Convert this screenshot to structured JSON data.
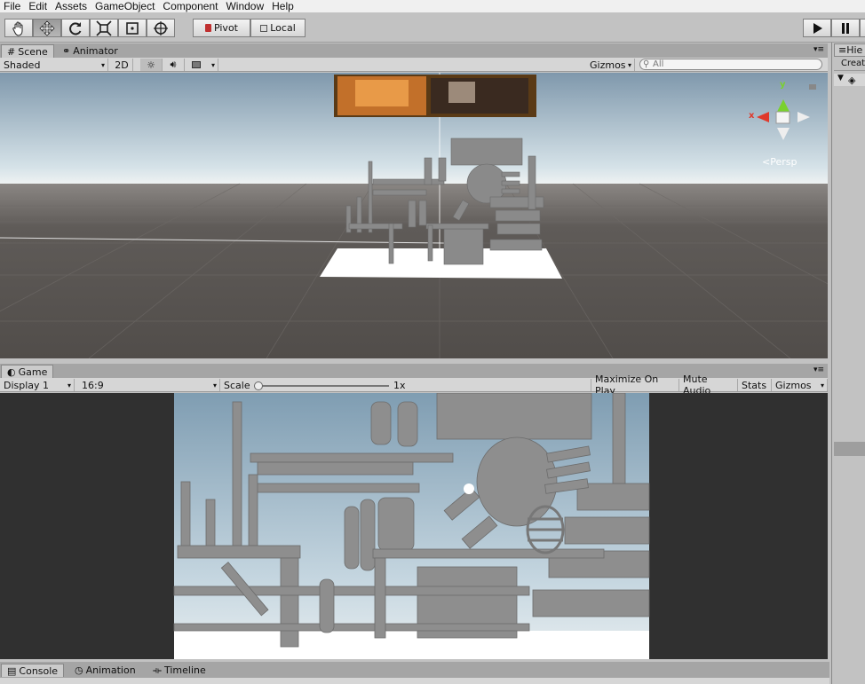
{
  "menu": [
    "File",
    "Edit",
    "Assets",
    "GameObject",
    "Component",
    "Window",
    "Help"
  ],
  "toolbar": {
    "tools": [
      "hand-tool",
      "move-tool",
      "rotate-tool",
      "scale-tool",
      "rect-tool",
      "transform-tool"
    ],
    "pivot_label": "Pivot",
    "local_label": "Local"
  },
  "scene_panel": {
    "tabs": [
      "Scene",
      "Animator"
    ],
    "shading_mode": "Shaded",
    "mode_2d": "2D",
    "gizmos_label": "Gizmos",
    "search_placeholder": "All",
    "persp_label": "Persp",
    "axis_x": "x",
    "axis_y": "y"
  },
  "game_panel": {
    "tab": "Game",
    "display": "Display 1",
    "aspect": "16:9",
    "scale_label": "Scale",
    "scale_value": "1x",
    "scale_level": 0.0,
    "maximize_label": "Maximize On Play",
    "mute_label": "Mute Audio",
    "stats_label": "Stats",
    "gizmos_label": "Gizmos"
  },
  "bottom_panel": {
    "tabs": [
      "Console",
      "Animation",
      "Timeline"
    ]
  },
  "hierarchy": {
    "tab_label": "Hie",
    "create_label": "Creat"
  },
  "colors": {
    "sky_top": "#7f98ac",
    "horizon": "#cfdde5",
    "ground": "#5a5754",
    "object_grey": "#8c8c8c",
    "game_bg": "#303030",
    "gizmo_x": "#e0392b",
    "gizmo_y": "#7ad12e"
  }
}
